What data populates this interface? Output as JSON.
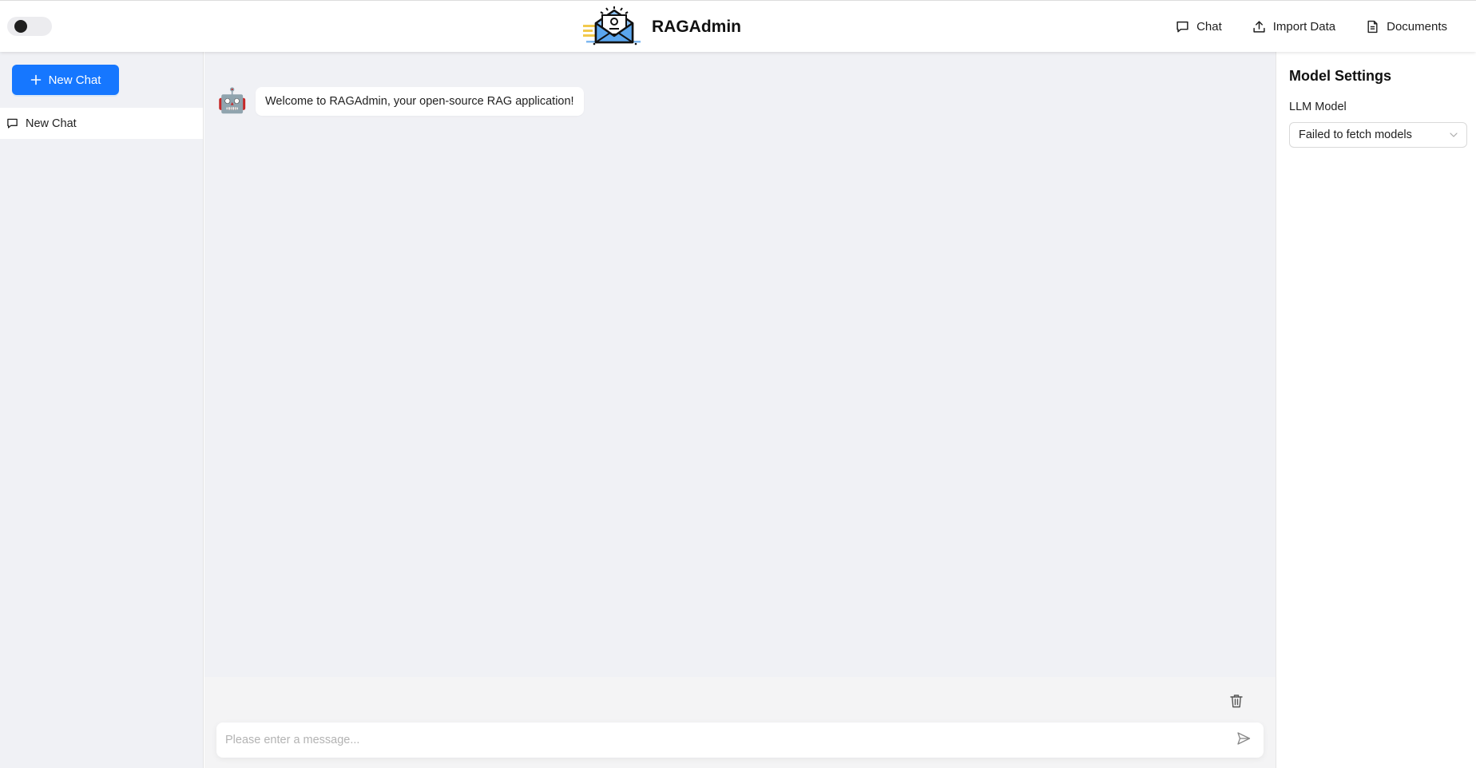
{
  "header": {
    "app_title": "RAGAdmin",
    "logo_icon": "envelope-robot-logo",
    "theme_toggle_icon": "theme-toggle",
    "nav": [
      {
        "label": "Chat",
        "icon": "message-icon"
      },
      {
        "label": "Import Data",
        "icon": "upload-icon"
      },
      {
        "label": "Documents",
        "icon": "document-icon"
      }
    ]
  },
  "sidebar": {
    "new_chat_label": "New Chat",
    "new_chat_icon": "plus-icon",
    "chats": [
      {
        "label": "New Chat",
        "icon": "message-icon"
      }
    ]
  },
  "chat": {
    "messages": [
      {
        "role": "assistant",
        "avatar": "🤖",
        "text": "Welcome to RAGAdmin, your open-source RAG application!"
      }
    ],
    "input_placeholder": "Please enter a message...",
    "input_value": "",
    "clear_icon": "trash-icon",
    "send_icon": "send-icon"
  },
  "settings": {
    "title": "Model Settings",
    "llm_label": "LLM Model",
    "llm_selected": "Failed to fetch models"
  },
  "colors": {
    "accent": "#1677ff",
    "panel_bg": "#f0f1f5"
  }
}
